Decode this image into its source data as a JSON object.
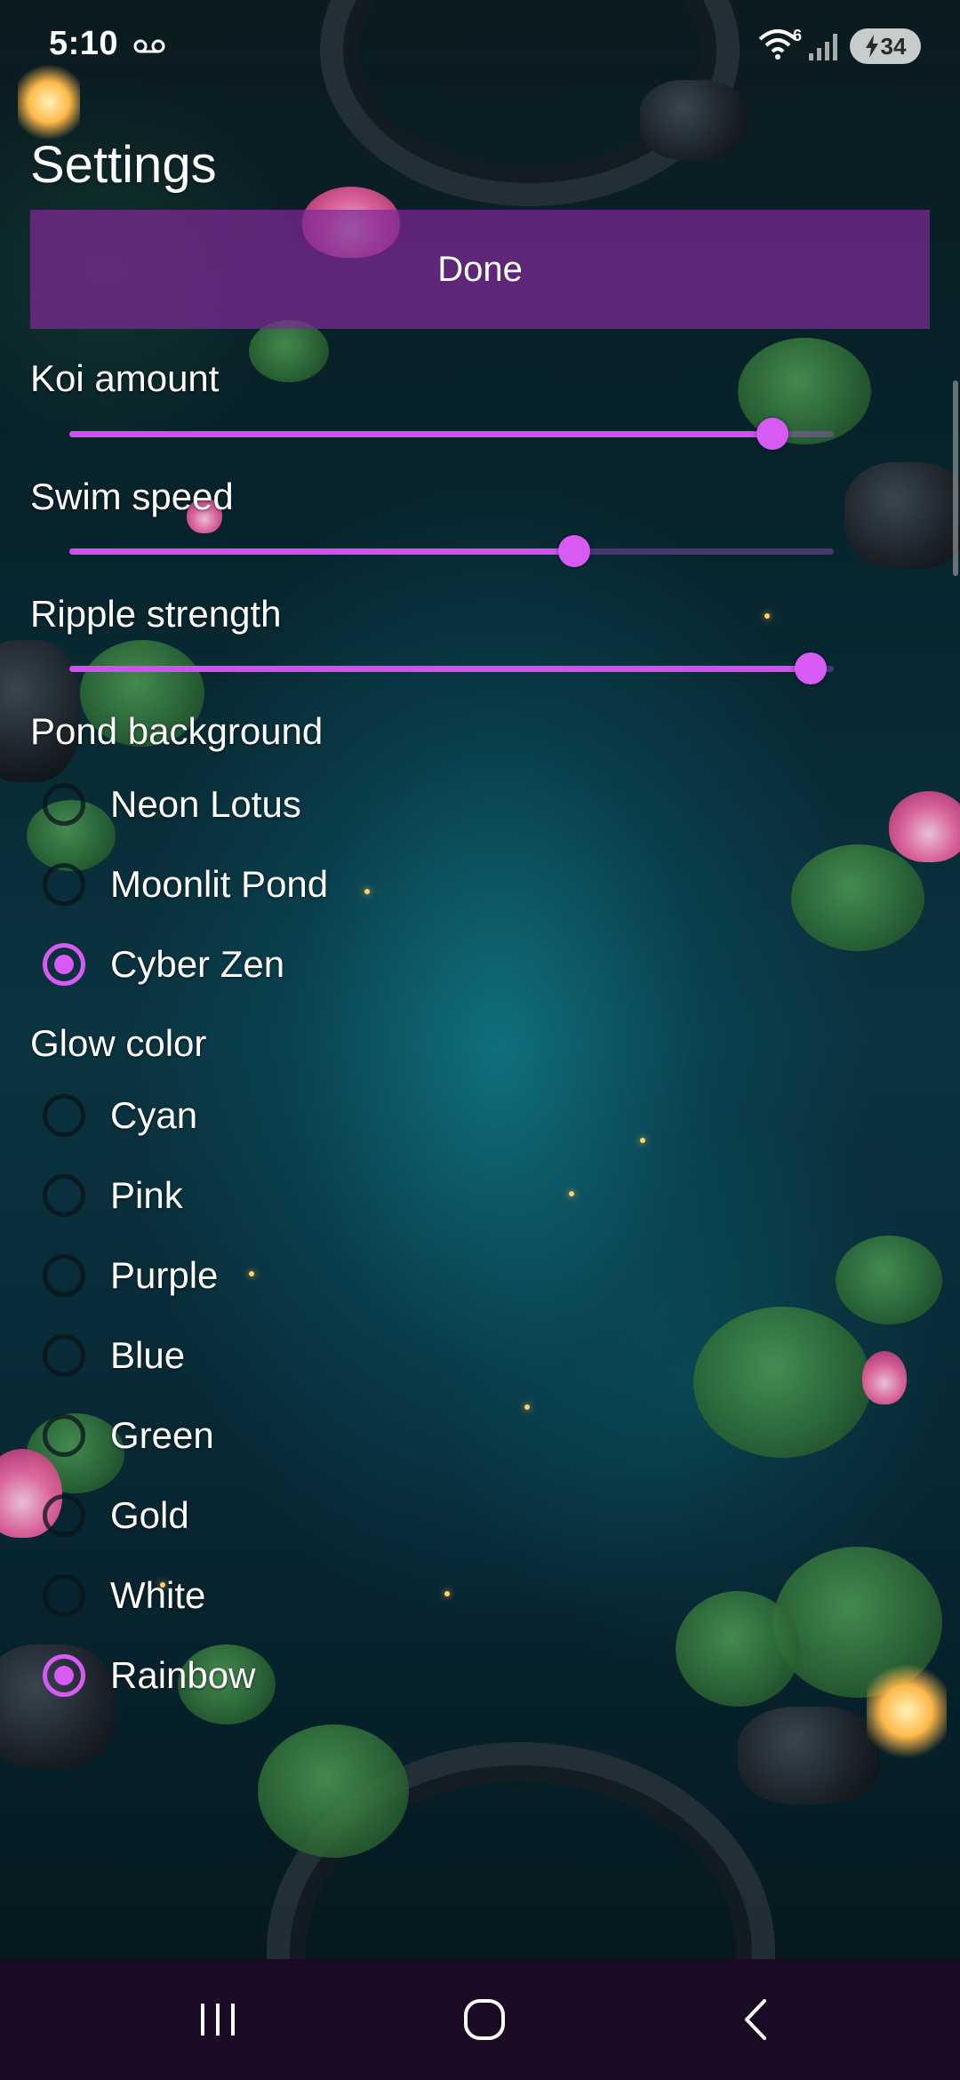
{
  "status_bar": {
    "time": "5:10",
    "wifi_superscript": "6",
    "battery_level": "34",
    "icons": [
      "voicemail-icon",
      "wifi-icon",
      "signal-icon",
      "battery-charging-icon"
    ]
  },
  "header": {
    "title": "Settings",
    "done_label": "Done"
  },
  "sliders": {
    "koi_amount": {
      "label": "Koi amount",
      "value": 0.92
    },
    "swim_speed": {
      "label": "Swim speed",
      "value": 0.66
    },
    "ripple_strength": {
      "label": "Ripple strength",
      "value": 0.97
    }
  },
  "pond_background": {
    "label": "Pond background",
    "options": [
      "Neon Lotus",
      "Moonlit Pond",
      "Cyber Zen"
    ],
    "selected": "Cyber Zen"
  },
  "glow_color": {
    "label": "Glow color",
    "options": [
      "Cyan",
      "Pink",
      "Purple",
      "Blue",
      "Green",
      "Gold",
      "White",
      "Rainbow"
    ],
    "selected": "Rainbow"
  },
  "nav_bar": {
    "icons": [
      "recents-icon",
      "home-icon",
      "back-icon"
    ]
  },
  "colors": {
    "accent": "#d75af4",
    "done_button_bg": "#80289699",
    "nav_bar_bg": "#1a0a24"
  }
}
